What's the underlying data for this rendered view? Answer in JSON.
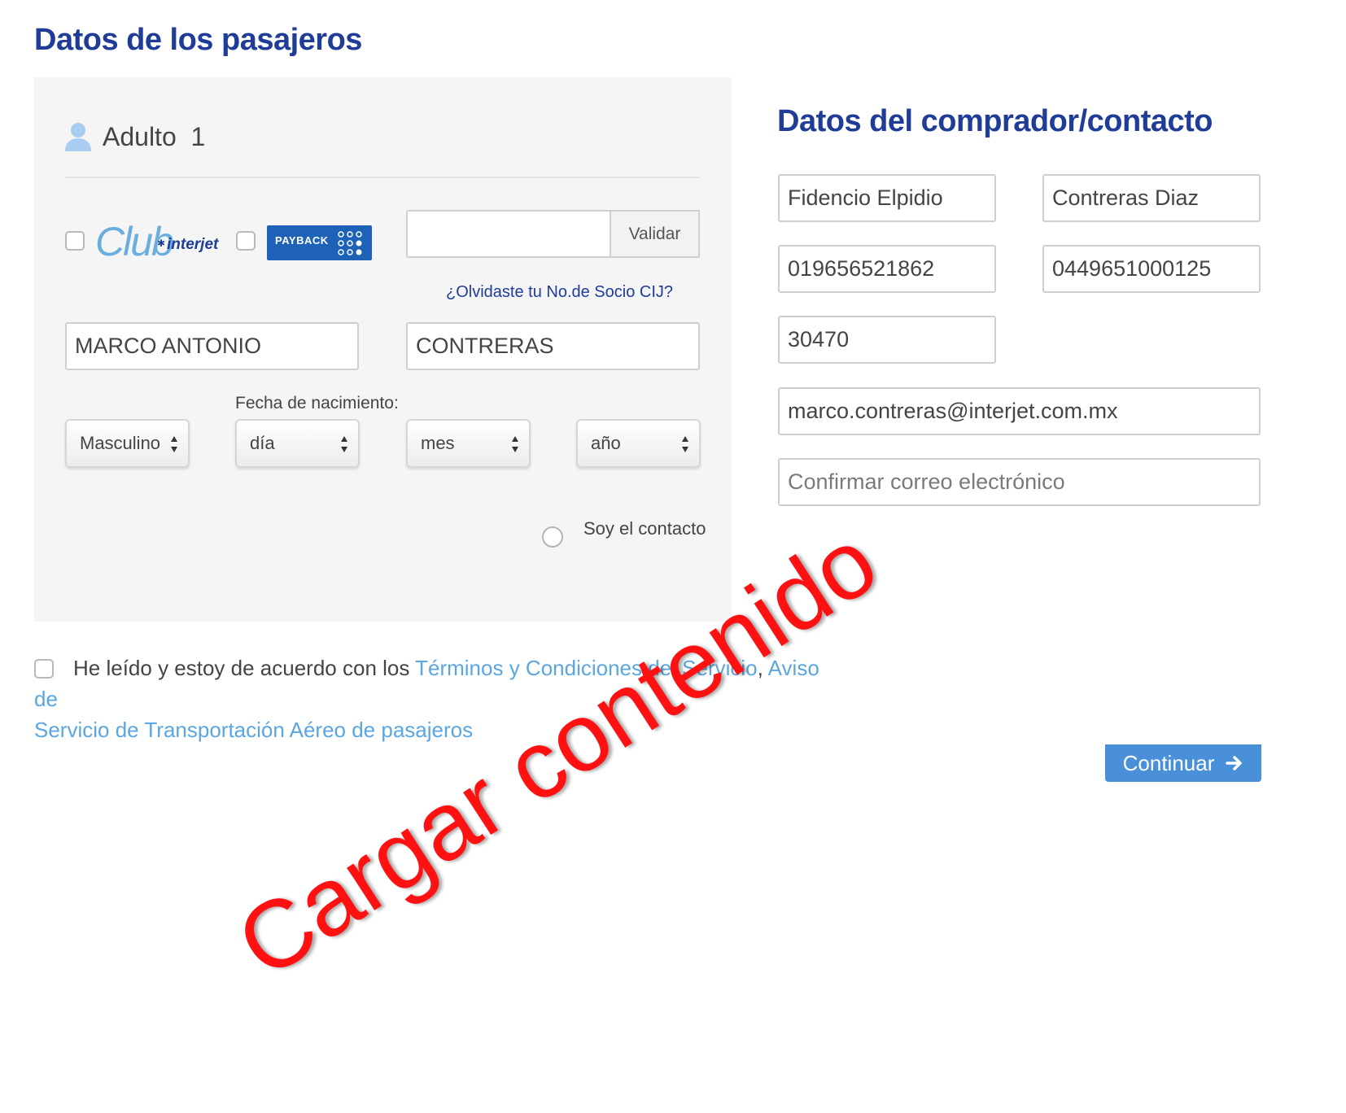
{
  "passengers": {
    "title": "Datos de los pasajeros",
    "adult_label": "Adulto",
    "adult_number": "1",
    "club_logo": {
      "word": "Club",
      "brand": "interjet"
    },
    "payback_logo": "PAYBACK",
    "member_input": {
      "value": "",
      "placeholder": ""
    },
    "validate_label": "Validar",
    "forgot_link": "¿Olvidaste tu No.de Socio CIJ?",
    "first_name": "MARCO ANTONIO",
    "last_name": "CONTRERAS",
    "birthdate_label": "Fecha de nacimiento:",
    "gender": "Masculino",
    "day": "día",
    "month": "mes",
    "year": "año",
    "contact_label": "Soy el contacto"
  },
  "buyer": {
    "title": "Datos del comprador/contacto",
    "first_name": "Fidencio Elpidio",
    "last_name": "Contreras Diaz",
    "phone": "019656521862",
    "mobile": "0449651000125",
    "zip": "30470",
    "email": "marco.contreras@interjet.com.mx",
    "confirm_email_placeholder": "Confirmar correo electrónico"
  },
  "terms": {
    "text": "He leído y estoy de acuerdo con los",
    "link1": "Términos y Condiciones del Servicio",
    "separator": ",",
    "link2_line1": "Aviso de",
    "link2_line2": "Servicio de Transportación Aéreo de pasajeros"
  },
  "continue_label": "Continuar",
  "overlay_text": "Cargar contenido",
  "colors": {
    "heading": "#1f3c96",
    "link": "#5ba6e0",
    "button": "#4a90d9",
    "overlay": "#ff1111",
    "panel": "#f5f5f5"
  },
  "icons": [
    "user-icon",
    "arrow-right-icon",
    "select-arrows-icon"
  ]
}
